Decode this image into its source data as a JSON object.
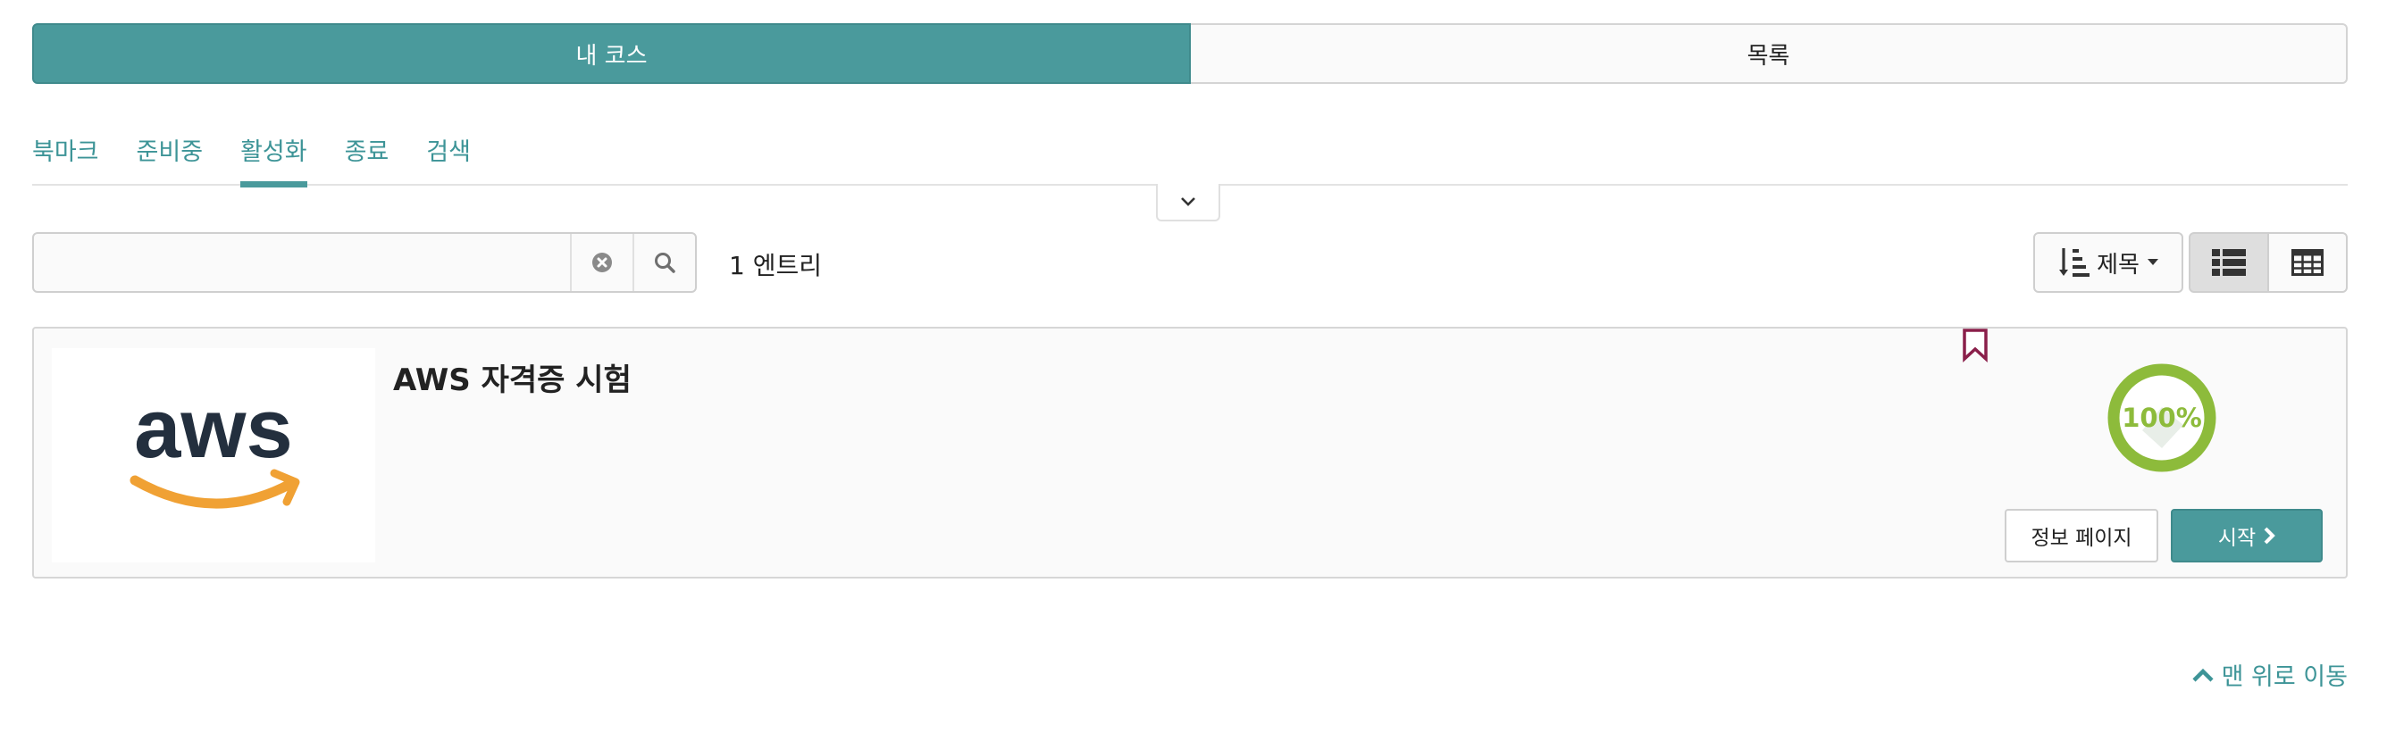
{
  "switcher": {
    "my_courses": "내 코스",
    "catalog": "목록"
  },
  "tabs": [
    {
      "label": "북마크"
    },
    {
      "label": "준비중"
    },
    {
      "label": "활성화",
      "active": true
    },
    {
      "label": "종료"
    },
    {
      "label": "검색"
    }
  ],
  "search": {
    "value": "",
    "placeholder": ""
  },
  "entries_label": "1 엔트리",
  "sort": {
    "label": "제목"
  },
  "courses": [
    {
      "title": "AWS 자격증 시험",
      "logo_text": "aws",
      "progress_percent": 100,
      "progress_label": "100%",
      "info_button": "정보 페이지",
      "start_button": "시작"
    }
  ],
  "back_to_top": "맨 위로 이동",
  "colors": {
    "accent": "#4a9a9c",
    "progress": "#8dbb3b",
    "bookmark": "#8a1f4a",
    "aws_text": "#232f3e",
    "aws_smile": "#f0a134"
  }
}
